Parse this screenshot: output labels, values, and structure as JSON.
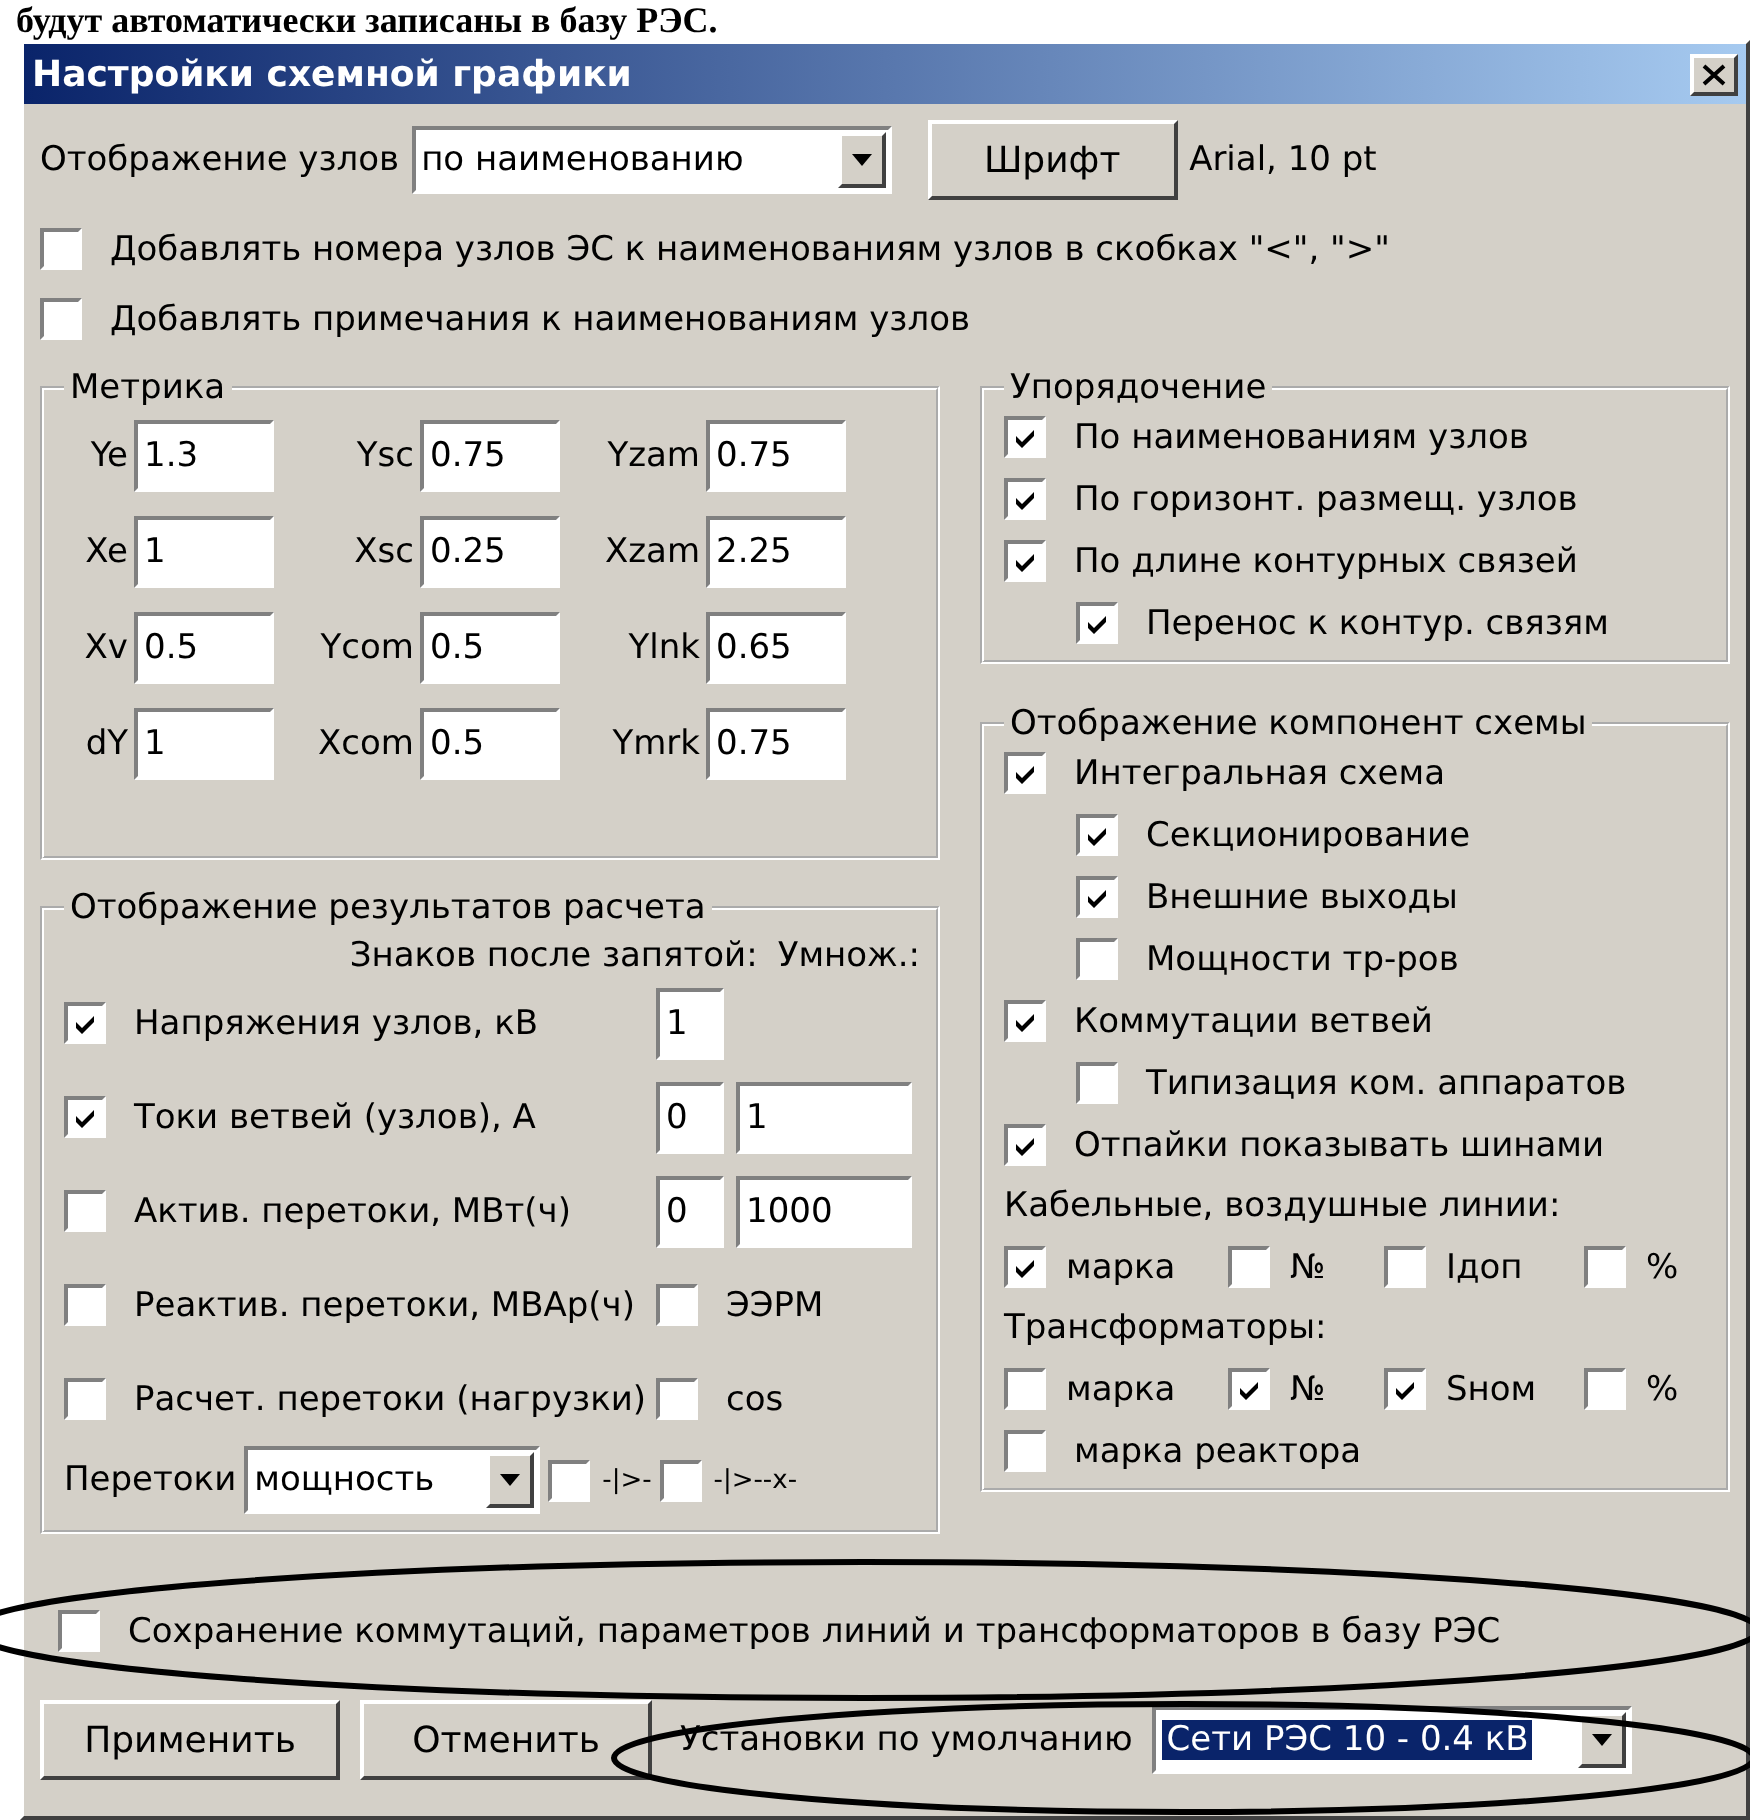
{
  "document_text": "будут автоматически записаны в базу РЭС.",
  "window": {
    "title": "Настройки схемной графики"
  },
  "node_display": {
    "label": "Отображение узлов",
    "value": "по наименованию"
  },
  "font": {
    "button": "Шрифт",
    "value": "Arial, 10 pt"
  },
  "top_options": [
    {
      "label": "Добавлять номера узлов ЭС к наименованиям узлов в скобках \"<\", \">\"",
      "checked": false
    },
    {
      "label": "Добавлять примечания к наименованиям узлов",
      "checked": false
    }
  ],
  "metrics": {
    "title": "Метрика",
    "fields": [
      {
        "label": "Ye",
        "value": "1.3"
      },
      {
        "label": "Ysc",
        "value": "0.75"
      },
      {
        "label": "Yzam",
        "value": "0.75"
      },
      {
        "label": "Xe",
        "value": "1"
      },
      {
        "label": "Xsc",
        "value": "0.25"
      },
      {
        "label": "Xzam",
        "value": "2.25"
      },
      {
        "label": "Xv",
        "value": "0.5"
      },
      {
        "label": "Ycom",
        "value": "0.5"
      },
      {
        "label": "Ylnk",
        "value": "0.65"
      },
      {
        "label": "dY",
        "value": "1"
      },
      {
        "label": "Xcom",
        "value": "0.5"
      },
      {
        "label": "Ymrk",
        "value": "0.75"
      }
    ]
  },
  "results": {
    "title": "Отображение результатов расчета",
    "decimals_header": "Знаков после запятой:",
    "multiplier_header": "Умнож.:",
    "rows": [
      {
        "label": "Напряжения узлов, кВ",
        "checked": true,
        "decimals": "1"
      },
      {
        "label": "Токи ветвей (узлов), А",
        "checked": true,
        "decimals": "0",
        "multiplier": "1"
      },
      {
        "label": "Актив. перетоки, МВт(ч)",
        "checked": false,
        "decimals": "0",
        "multiplier": "1000"
      },
      {
        "label": "Реактив. перетоки, МВАр(ч)",
        "checked": false,
        "extra": {
          "label": "ЭЭРМ",
          "checked": false
        }
      },
      {
        "label": "Расчет. перетоки (нагрузки)",
        "checked": false,
        "extra": {
          "label": "cos",
          "checked": false
        }
      }
    ],
    "flows": {
      "label": "Перетоки",
      "value": "мощность",
      "options": [
        {
          "label": "-|>-",
          "checked": false
        },
        {
          "label": "-|>--x-",
          "checked": false
        }
      ]
    }
  },
  "ordering": {
    "title": "Упорядочение",
    "items": [
      {
        "label": "По наименованиям узлов",
        "checked": true
      },
      {
        "label": "По горизонт. размещ. узлов",
        "checked": true
      },
      {
        "label": "По длине контурных связей",
        "checked": true,
        "children": [
          {
            "label": "Перенос к контур. связям",
            "checked": true
          }
        ]
      }
    ]
  },
  "components": {
    "title": "Отображение компонент схемы",
    "items": [
      {
        "label": "Интегральная схема",
        "checked": true,
        "children": [
          {
            "label": "Секционирование",
            "checked": true
          },
          {
            "label": "Внешние выходы",
            "checked": true
          },
          {
            "label": "Мощности тр-ров",
            "checked": false
          }
        ]
      },
      {
        "label": "Коммутации ветвей",
        "checked": true,
        "children": [
          {
            "label": "Типизация ком. аппаратов",
            "checked": false
          }
        ]
      },
      {
        "label": "Отпайки показывать шинами",
        "checked": true
      }
    ],
    "lines": {
      "label": "Кабельные, воздушные линии:",
      "options": [
        {
          "label": "марка",
          "checked": true
        },
        {
          "label": "№",
          "checked": false
        },
        {
          "label": "Iдоп",
          "checked": false
        },
        {
          "label": "%",
          "checked": false
        }
      ]
    },
    "transformers": {
      "label": "Трансформаторы:",
      "options": [
        {
          "label": "марка",
          "checked": false
        },
        {
          "label": "№",
          "checked": true
        },
        {
          "label": "Sном",
          "checked": true
        },
        {
          "label": "%",
          "checked": false
        }
      ]
    },
    "reactor": {
      "label": "марка реактора",
      "checked": false
    }
  },
  "save_option": {
    "label": "Сохранение коммутаций, параметров линий и трансформаторов в базу РЭС",
    "checked": false
  },
  "buttons": [
    "Применить",
    "Отменить"
  ],
  "defaults": {
    "label": "Установки по умолчанию",
    "value": "Сети РЭС 10 - 0.4 кВ"
  }
}
